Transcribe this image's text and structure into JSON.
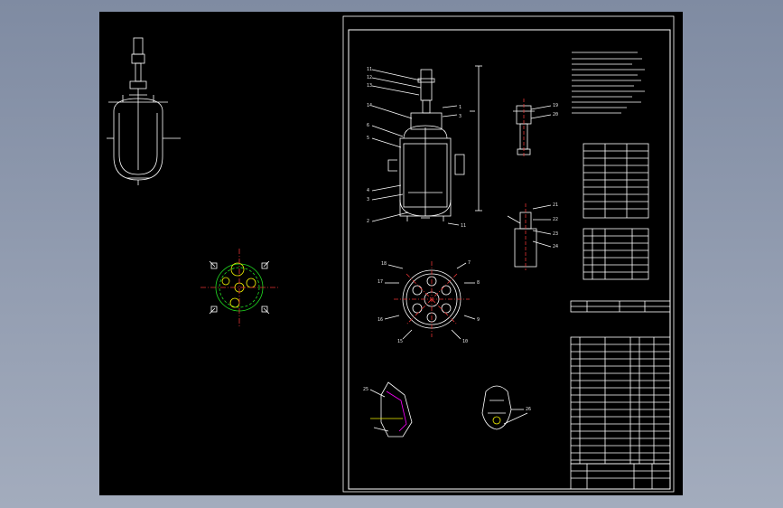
{
  "colors": {
    "background": "#8f9bb0",
    "drawing_area": "#000000",
    "line": "#ffffff",
    "green": "#22dd22",
    "magenta": "#ff00ff",
    "cyan": "#00d7d7",
    "yellow": "#f2f200",
    "red": "#e33333"
  },
  "drawing": {
    "leader_numbers_main": [
      "11",
      "12",
      "13",
      "14",
      "6",
      "5",
      "4",
      "3",
      "2",
      "1",
      "3",
      "11"
    ],
    "leader_numbers_detail_a": [
      "19",
      "20"
    ],
    "leader_numbers_detail_b": [
      "21",
      "22",
      "23",
      "24"
    ],
    "leader_numbers_plan": [
      "18",
      "17",
      "16",
      "15",
      "10",
      "9",
      "8",
      "7"
    ],
    "leader_numbers_bottom": [
      "25",
      "26"
    ]
  }
}
